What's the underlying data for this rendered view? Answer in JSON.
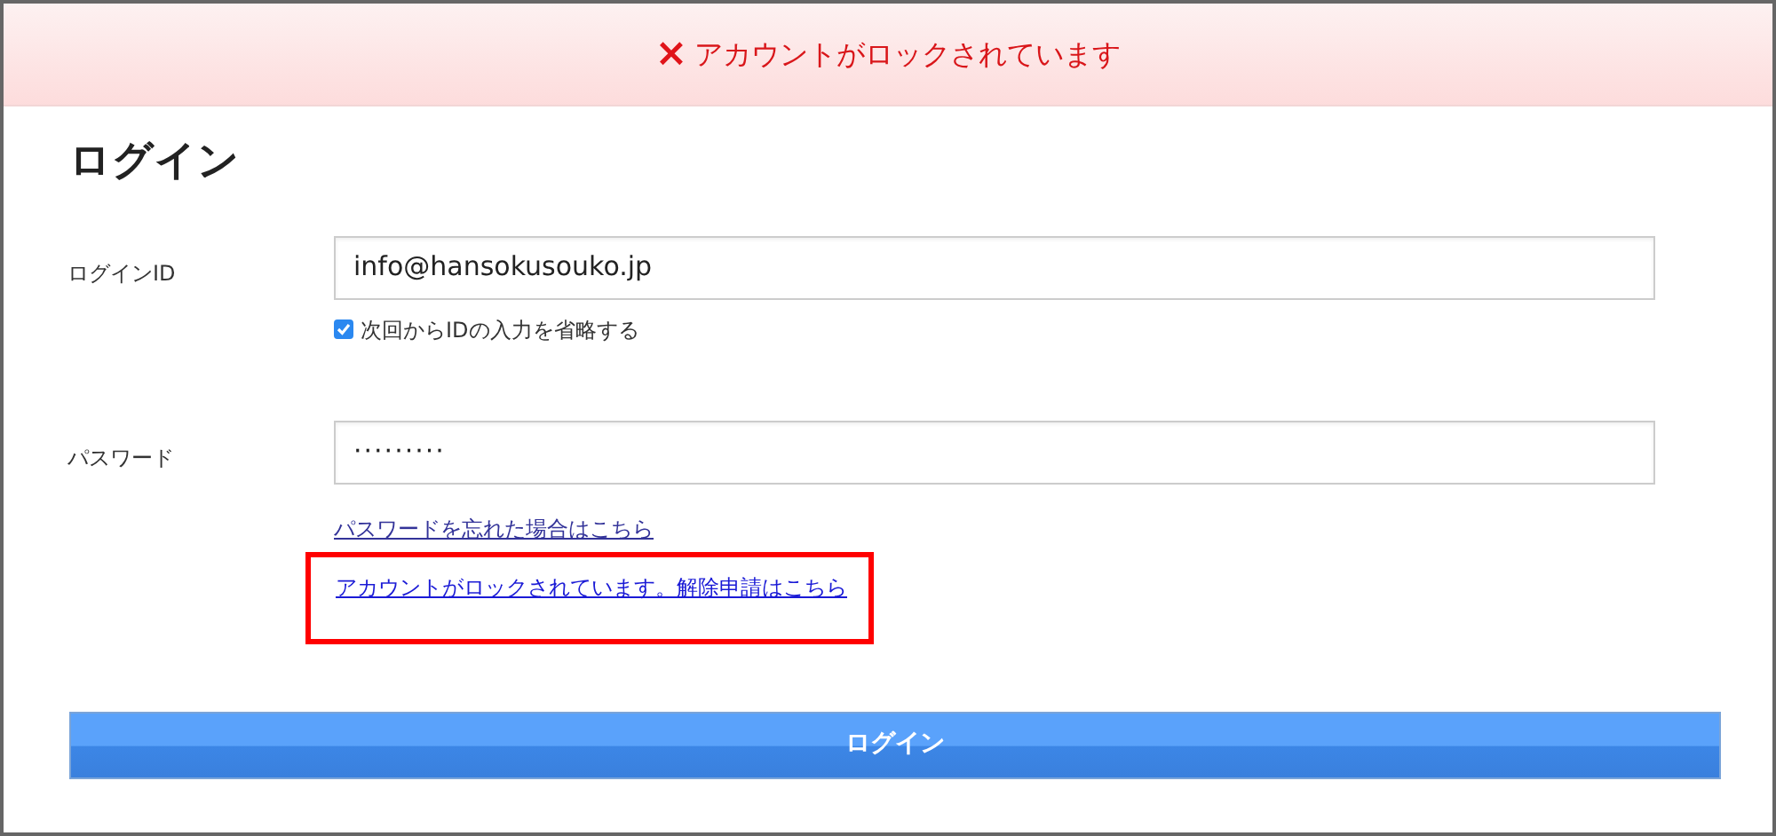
{
  "alert": {
    "icon": "×",
    "message": "アカウントがロックされています"
  },
  "title": "ログイン",
  "fields": [
    {
      "kind": "text",
      "label": "ログインID",
      "value": "info@hansokusouko.jp"
    },
    {
      "kind": "password",
      "label": "パスワード",
      "value": "·········"
    }
  ],
  "remember": {
    "label": "次回からIDの入力を省略する",
    "checked": true
  },
  "links": [
    {
      "text": "パスワードを忘れた場合はこちら",
      "highlighted": false
    },
    {
      "text": "アカウントがロックされています。解除申請はこちら",
      "highlighted": true
    }
  ],
  "submit": "ログイン"
}
